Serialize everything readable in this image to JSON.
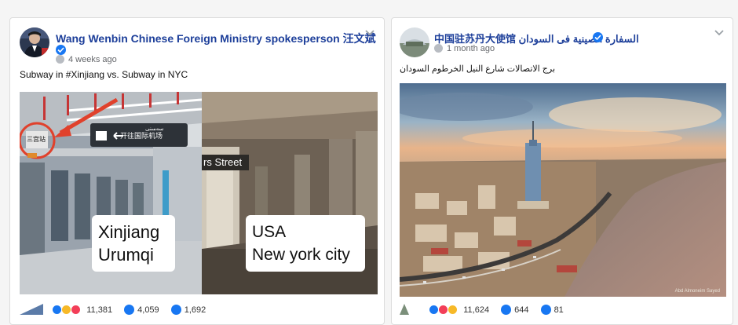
{
  "post_left": {
    "author": "Wang Wenbin Chinese Foreign Ministry spokesperson 汪文斌",
    "time": "4 weeks ago",
    "text": "Subway in #Xinjiang vs. Subway in NYC",
    "photo": {
      "sign_top": "سەمىنى",
      "sign_left": "三宫站",
      "station_label": "开往国际机场",
      "street_text": "rs Street",
      "label_xinjiang_1": "Xinjiang",
      "label_xinjiang_2": "Urumqi",
      "label_usa_1": "USA",
      "label_usa_2": "New york city"
    },
    "stats": {
      "reactions": "11,381",
      "comments": "4,059",
      "shares": "1,692"
    }
  },
  "post_right": {
    "author": "中国驻苏丹大使馆 السفارة الصينية فى السودان",
    "time": "1 month ago",
    "text": "برج الاتصالات شارع النيل الخرطوم السودان",
    "photo": {
      "credit": "Abd Almoneim Sayed"
    },
    "stats": {
      "reactions": "11,624",
      "comments": "644",
      "shares": "81"
    }
  },
  "colors": {
    "link": "#1d3f9a",
    "verified": "#1877f2",
    "meta": "#65676b"
  },
  "icons": [
    "verified-icon",
    "globe-icon",
    "chevron-down-icon",
    "like-icon",
    "love-icon",
    "haha-icon",
    "comment-icon",
    "share-icon",
    "arrow-left-icon",
    "train-icon"
  ]
}
